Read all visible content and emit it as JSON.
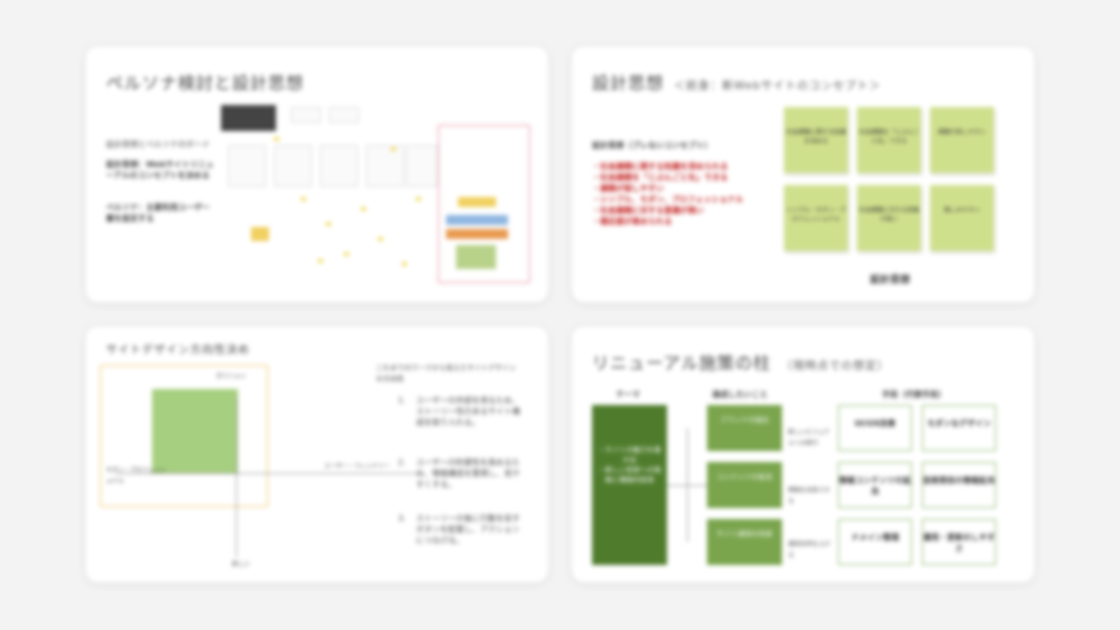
{
  "slides": {
    "persona": {
      "title": "ペルソナ検討と設計思想",
      "subtitle": "設計思想とペルソナのボード",
      "point1": "設計思想：Webサイトリニューアルのコンセプトを決める",
      "point2": "ペルソナ：主要利用ユーザー層を設定する"
    },
    "concept": {
      "title": "設計思想",
      "title_note": "＜前身：新Webサイトのコンセプト＞",
      "heading": "設計思想（ブレないコンセプト）",
      "items": [
        "・社会課題に関する知識を深められる",
        "・社会課題を「じぶんごと化」できる",
        "・課題が探しやすい",
        "・シンプル、モダン、プロフェッショナル",
        "・社会課題に対する意識が高い",
        "・親近感が高められる"
      ],
      "stickies": [
        "社会課題に関する知識を深める",
        "社会課題を「じぶんごと化」できる",
        "課題が探しやすい",
        "シンプル・モダン・プロフェッショナル",
        "社会課題に対する意識が高い",
        "親しみやすい"
      ],
      "caption": "設計思想"
    },
    "direction": {
      "title": "サイトデザイン方向性決め",
      "intro": "これまでのワークから見えたサイトデザインの方向性",
      "points": [
        "ユーザーの共感を得るため、ストーリー性のあるサイト構成を取り入れる。",
        "ユーザーの利便性を高めるため、情報構造を整理し、見やすくする。",
        "ストーリーの後に行動を促すボタンを配置し、アクションにつなげる。"
      ],
      "legend": "ポジション",
      "axis_left": "モダン・プロフェッショナル",
      "axis_right": "ユーザー・フレンドリー",
      "axis_bottom": "新しい"
    },
    "renewal": {
      "title": "リニューアル施策の柱",
      "title_note": "（現時点での想定）",
      "col_theme": "テーマ",
      "col_goal": "達成したいこと",
      "col_measures": "手段（代替手段）",
      "theme_text": "・サイトの魅力を最大化\n・新しい技術への挑戦と積極的採用",
      "goals": [
        "ブランドの強化",
        "コンテンツの拡充",
        "サイト運用の改善"
      ],
      "goal_notes": [
        "新しいビジュアルへの移行",
        "情報を充実させる",
        "運用効率を上げる"
      ],
      "measures": [
        "UI/UX改善",
        "モダンなデザイン",
        "情報コンテンツの拡充",
        "技術発信の情報拡充",
        "ドメイン整理",
        "運用・更新のしやすさ"
      ]
    }
  }
}
